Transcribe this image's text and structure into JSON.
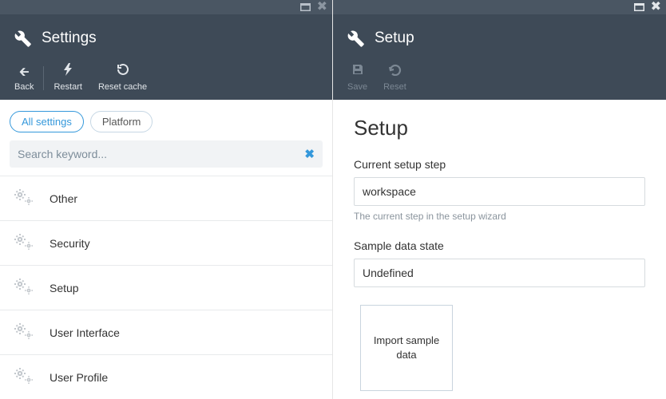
{
  "left": {
    "title": "Settings",
    "toolbar": {
      "back": "Back",
      "restart": "Restart",
      "reset_cache": "Reset cache"
    },
    "filters": {
      "all": "All settings",
      "platform": "Platform"
    },
    "search": {
      "placeholder": "Search keyword..."
    },
    "items": [
      {
        "label": "Other"
      },
      {
        "label": "Security"
      },
      {
        "label": "Setup"
      },
      {
        "label": "User Interface"
      },
      {
        "label": "User Profile"
      }
    ]
  },
  "right": {
    "title": "Setup",
    "toolbar": {
      "save": "Save",
      "reset": "Reset"
    },
    "heading": "Setup",
    "fields": {
      "current_step": {
        "label": "Current setup step",
        "value": "workspace",
        "help": "The current step in the setup wizard"
      },
      "sample_state": {
        "label": "Sample data state",
        "value": "Undefined"
      }
    },
    "import_btn": "Import sample data"
  }
}
